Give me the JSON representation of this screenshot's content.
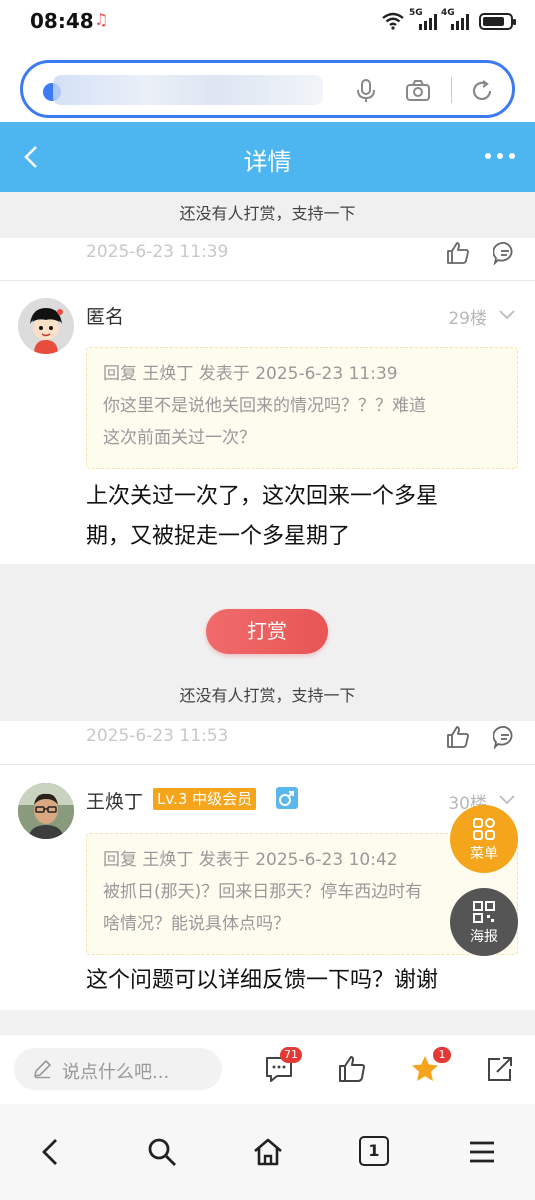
{
  "status_bar": {
    "time": "08:48",
    "net1": "5G",
    "net2": "4G"
  },
  "header": {
    "title": "详情"
  },
  "reward_tip_1": "还没有人打赏，支持一下",
  "post_1": {
    "date": "2025-6-23 11:39"
  },
  "post_2": {
    "author": "匿名",
    "floor": "29楼",
    "quote_line1": "回复 王焕丁 发表于 2025-6-23 11:39",
    "quote_line2": "你这里不是说他关回来的情况吗？？？难道",
    "quote_line3": "这次前面关过一次？",
    "reply_line1": "上次关过一次了，这次回来一个多星",
    "reply_line2": "期，又被捉走一个多星期了"
  },
  "reward_button": "打赏",
  "reward_tip_2": "还没有人打赏，支持一下",
  "post_2_date": "2025-6-23 11:53",
  "post_3": {
    "author": "王焕丁",
    "level": "Lv.3 中级会员",
    "floor": "30楼",
    "quote_line1": "回复 王焕丁 发表于 2025-6-23 10:42",
    "quote_line2": "被抓日(那天)？回来日那天？停车西边时有",
    "quote_line3": "啥情况？能说具体点吗？",
    "reply_line1": "这个问题可以详细反馈一下吗？谢谢"
  },
  "float_menu": {
    "menu_label": "菜单",
    "poster_label": "海报"
  },
  "action_bar": {
    "comment_placeholder": "说点什么吧...",
    "comment_count": "71",
    "favorite_count": "1"
  },
  "browser_nav": {
    "tab_count": "1"
  },
  "colors": {
    "header_bg": "#4db5f0",
    "accent_orange": "#f5a51b",
    "reward_red": "#e85555",
    "search_border": "#3d7bf2"
  }
}
